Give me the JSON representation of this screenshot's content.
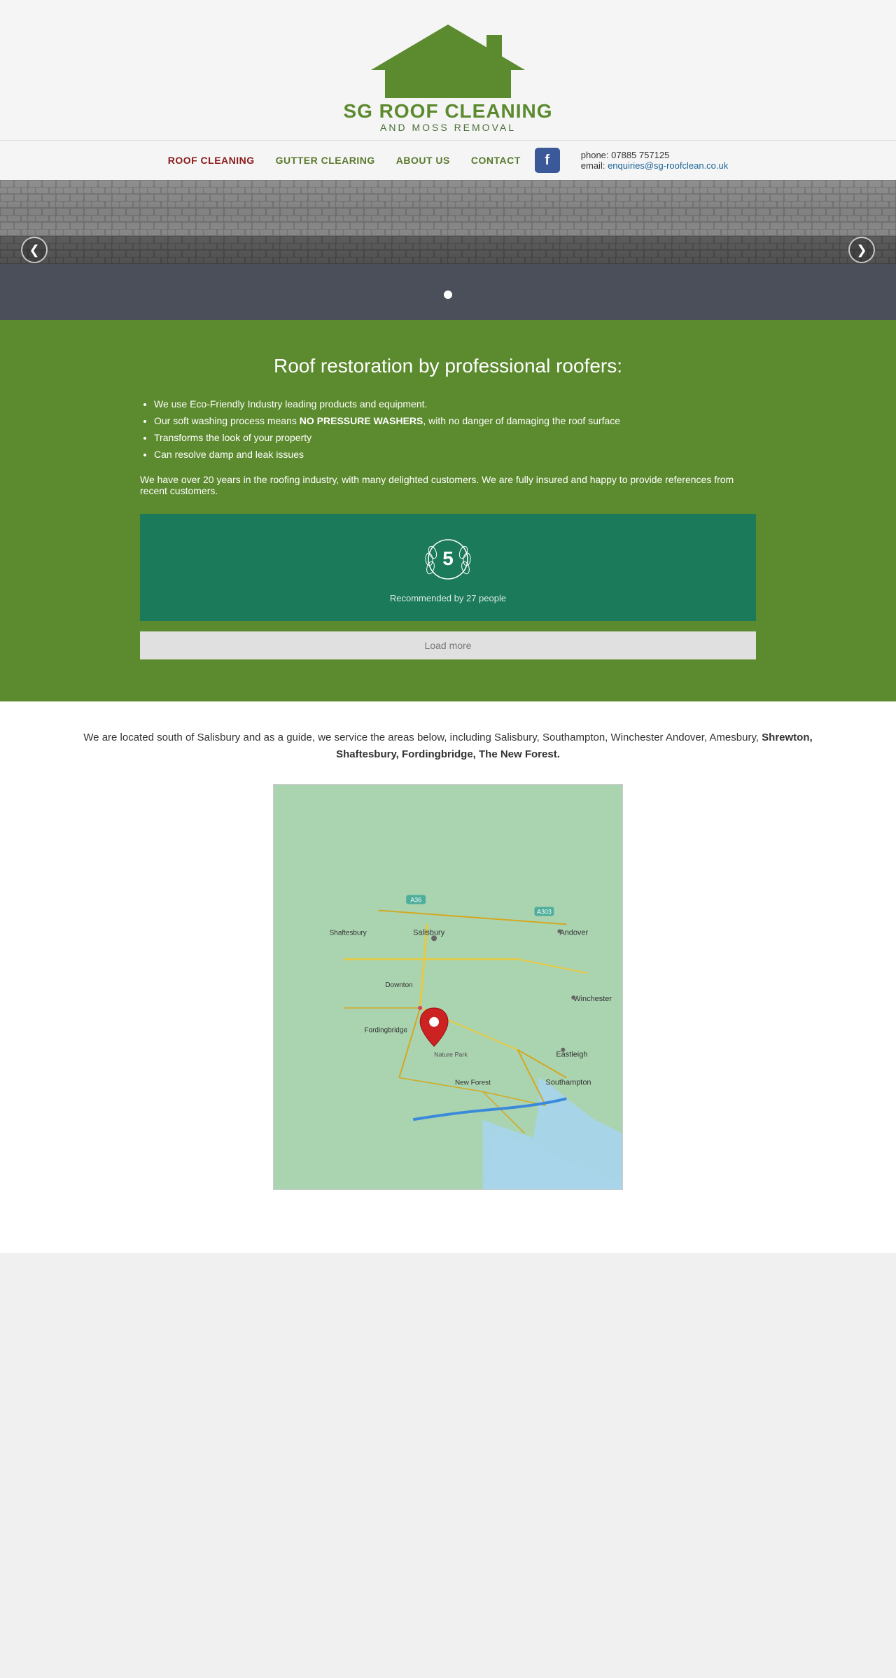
{
  "header": {
    "logo_line1": "SG ROOF CLEANING",
    "logo_line2": "AND MOSS REMOVAL",
    "tagline": "SG ROOF CLEANING AND MOSS REMOVAL"
  },
  "nav": {
    "items": [
      {
        "label": "ROOF CLEANING",
        "class": "roof",
        "name": "roof-cleaning"
      },
      {
        "label": "GUTTER CLEARING",
        "class": "gutter",
        "name": "gutter-clearing"
      },
      {
        "label": "ABOUT US",
        "class": "about",
        "name": "about-us"
      },
      {
        "label": "CONTACT",
        "class": "contact",
        "name": "contact"
      }
    ],
    "phone_label": "phone:",
    "phone_number": "07885 757125",
    "email_label": "email:",
    "email": "enquiries@sg-roofclean.co.uk"
  },
  "slider": {
    "prev_arrow": "❮",
    "next_arrow": "❯"
  },
  "green_section": {
    "heading": "Roof restoration by professional roofers:",
    "bullets": [
      "We use Eco-Friendly Industry leading products and equipment.",
      "Our soft washing process means NO PRESSURE WASHERS, with no danger of damaging the roof surface",
      "Transforms the look of your property",
      "Can resolve damp and leak issues"
    ],
    "body_text": "We have over 20 years in the roofing industry, with many delighted customers. We are fully insured and happy to provide references from recent customers.",
    "rating_number": "5",
    "rating_subtitle": "Recommended by 27 people",
    "load_more": "Load more"
  },
  "location_section": {
    "description": "We are located south of Salisbury and as a guide, we service the areas below, including Salisbury, Southampton, Winchester Andover, Amesbury, Shrewton, Shaftesbury, Fordingbridge, The New Forest."
  },
  "map": {
    "pin_label": "Location Pin",
    "alt": "Map showing service area around Salisbury, Hampshire"
  }
}
